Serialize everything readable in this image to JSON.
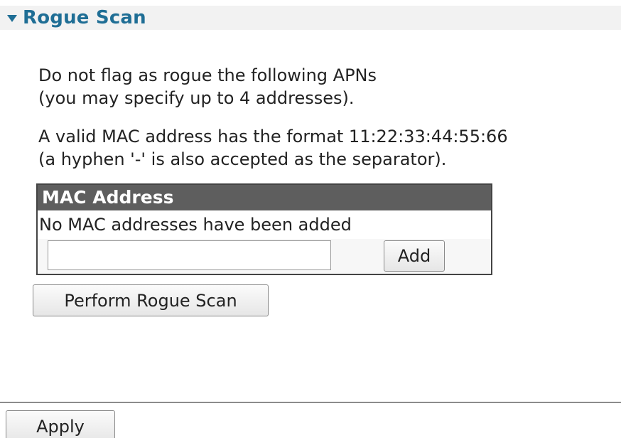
{
  "section": {
    "title": "Rogue Scan"
  },
  "description": {
    "line1": "Do not flag as rogue the following APNs",
    "line2": "(you may specify up to 4 addresses).",
    "line3": "A valid MAC address has the format 11:22:33:44:55:66",
    "line4": "(a hyphen '-' is also accepted as the separator)."
  },
  "mac_table": {
    "header": "MAC Address",
    "empty_message": "No MAC addresses have been added",
    "input_value": "",
    "add_label": "Add"
  },
  "actions": {
    "scan_label": "Perform Rogue Scan",
    "apply_label": "Apply"
  },
  "colors": {
    "header_text": "#1f6e95",
    "header_bg": "#f2f2f2",
    "table_header_bg": "#5e5e5e"
  }
}
